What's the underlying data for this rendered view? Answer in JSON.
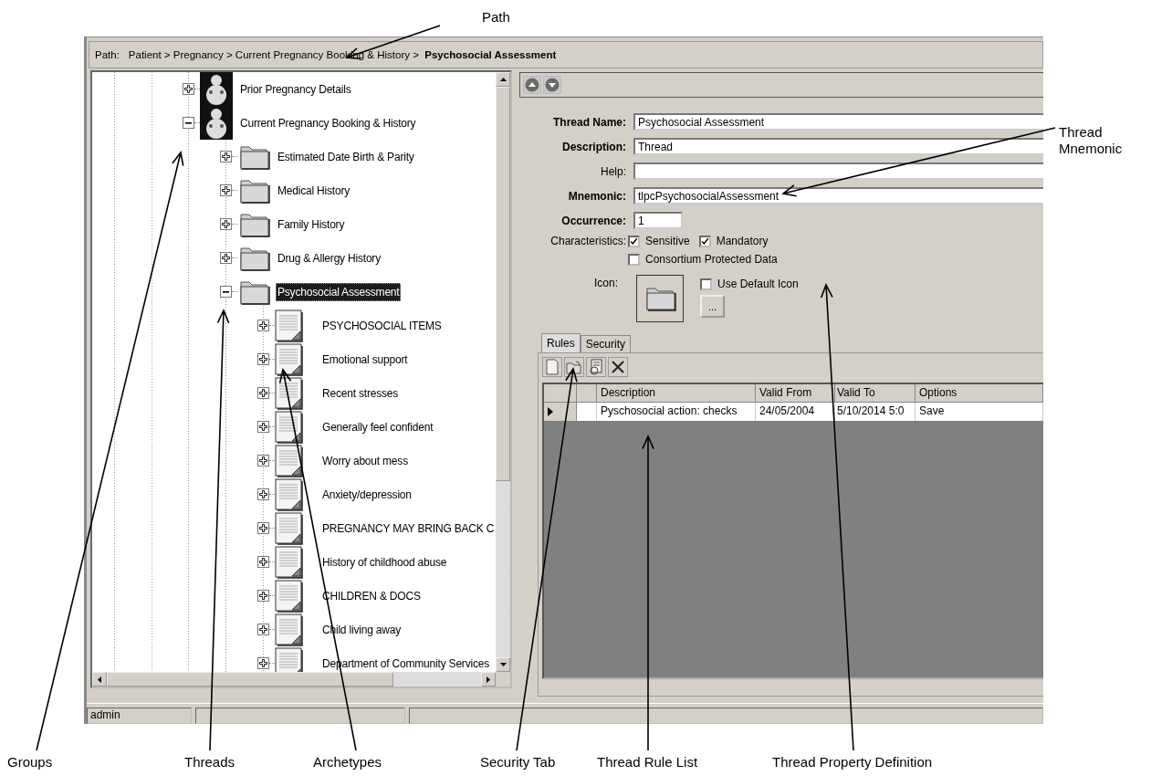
{
  "path_bar": {
    "label": "Path:",
    "path": "Patient > Pregnancy > Current Pregnancy Booking & History >  **Psychosocial Assessment**"
  },
  "tree": {
    "items": [
      {
        "label": "Prior Pregnancy Details",
        "kind": "group",
        "expanded": false,
        "selected": false
      },
      {
        "label": "Current Pregnancy Booking & History",
        "kind": "group",
        "expanded": true,
        "selected": false,
        "children": [
          {
            "label": "Estimated Date Birth & Parity",
            "kind": "thread",
            "expanded": false,
            "selected": false
          },
          {
            "label": "Medical History",
            "kind": "thread",
            "expanded": false,
            "selected": false
          },
          {
            "label": "Family History",
            "kind": "thread",
            "expanded": false,
            "selected": false
          },
          {
            "label": "Drug & Allergy History",
            "kind": "thread",
            "expanded": false,
            "selected": false
          },
          {
            "label": "Psychosocial Assessment",
            "kind": "thread",
            "expanded": true,
            "selected": true,
            "children": [
              {
                "label": "PSYCHOSOCIAL ITEMS",
                "kind": "archetype",
                "expanded": false,
                "selected": false
              },
              {
                "label": "Emotional support",
                "kind": "archetype",
                "expanded": false,
                "selected": false
              },
              {
                "label": "Recent stresses",
                "kind": "archetype",
                "expanded": false,
                "selected": false
              },
              {
                "label": "Generally feel confident",
                "kind": "archetype",
                "expanded": false,
                "selected": false
              },
              {
                "label": "Worry about mess",
                "kind": "archetype",
                "expanded": false,
                "selected": false
              },
              {
                "label": "Anxiety/depression",
                "kind": "archetype",
                "expanded": false,
                "selected": false
              },
              {
                "label": "PREGNANCY MAY BRING BACK C",
                "kind": "archetype",
                "expanded": false,
                "selected": false
              },
              {
                "label": "History of childhood abuse",
                "kind": "archetype",
                "expanded": false,
                "selected": false
              },
              {
                "label": "CHILDREN & DOCS",
                "kind": "archetype",
                "expanded": false,
                "selected": false
              },
              {
                "label": "Child living away",
                "kind": "archetype",
                "expanded": false,
                "selected": false
              },
              {
                "label": "Department of Community Services",
                "kind": "archetype",
                "expanded": false,
                "selected": false
              }
            ]
          }
        ]
      }
    ]
  },
  "form": {
    "fields": [
      {
        "label": "Thread Name:",
        "required": true,
        "kind": "text",
        "value": "Psychosocial Assessment"
      },
      {
        "label": "Description:",
        "required": true,
        "kind": "text",
        "value": "Thread"
      },
      {
        "label": "Help:",
        "required": false,
        "kind": "text"
      },
      {
        "label": "Mnemonic:",
        "required": true,
        "kind": "text",
        "value": "tlpcPsychosocialAssessment"
      },
      {
        "label": "Occurrence:",
        "required": true,
        "kind": "number",
        "value": "1"
      }
    ],
    "characteristics": {
      "label": "Characteristics:",
      "options": [
        {
          "label": "Sensitive",
          "checked": true
        },
        {
          "label": "Mandatory",
          "checked": true
        },
        {
          "label": "Consortium Protected Data",
          "checked": false
        }
      ]
    },
    "icon": {
      "label": "Icon:",
      "use_default": {
        "label": "Use Default Icon",
        "checked": false
      },
      "browse_button": "..."
    }
  },
  "tabs": [
    {
      "label": "Rules",
      "selected": true
    },
    {
      "label": "Security",
      "selected": false
    }
  ],
  "rules_table": {
    "columns": [
      "Description",
      "Valid From",
      "Valid To",
      "Options"
    ],
    "rows": [
      {
        "selected": true,
        "cells": [
          "Pyschosocial action: checks",
          "24/05/2004",
          "5/10/2014 5:0",
          "Save"
        ]
      }
    ]
  },
  "status_bar": {
    "user": "admin"
  },
  "annotations": [
    {
      "label": "Path"
    },
    {
      "label": "Thread Mnemonic"
    },
    {
      "label": "Groups"
    },
    {
      "label": "Threads"
    },
    {
      "label": "Archetypes"
    },
    {
      "label": "Security Tab"
    },
    {
      "label": "Thread Rule List"
    },
    {
      "label": "Thread Property Definition"
    }
  ]
}
